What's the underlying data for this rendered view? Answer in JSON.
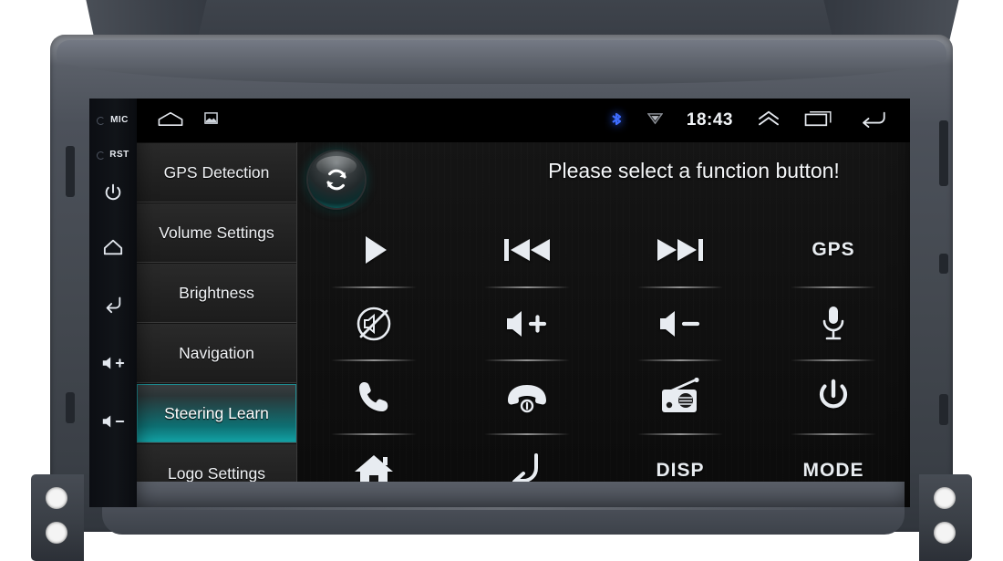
{
  "device": {
    "type": "car-head-unit",
    "bezel_color": "#4c515a",
    "screen_bg": "#000000"
  },
  "side_keys": [
    {
      "name": "mic",
      "label": "MIC",
      "icon": "mic-hole-icon"
    },
    {
      "name": "reset",
      "label": "RST",
      "icon": "reset-hole-icon"
    },
    {
      "name": "power",
      "label": "",
      "icon": "power-icon"
    },
    {
      "name": "home",
      "label": "",
      "icon": "home-icon"
    },
    {
      "name": "back",
      "label": "",
      "icon": "back-icon"
    },
    {
      "name": "volume-up",
      "label": "",
      "icon": "volume-up-icon"
    },
    {
      "name": "volume-down",
      "label": "",
      "icon": "volume-down-icon"
    }
  ],
  "statusbar": {
    "left_icons": [
      "home-outline-icon",
      "screenshot-icon"
    ],
    "bluetooth_icon": "bluetooth-icon",
    "bluetooth_color": "#2b5fff",
    "signal_icon": "signal-icon",
    "time": "18:43",
    "right_icons": [
      "chevron-up-icon",
      "recents-icon",
      "back-arrow-icon"
    ]
  },
  "sidebar": {
    "items": [
      {
        "label": "GPS Detection",
        "active": false
      },
      {
        "label": "Volume Settings",
        "active": false
      },
      {
        "label": "Brightness",
        "active": false
      },
      {
        "label": "Navigation",
        "active": false
      },
      {
        "label": "Steering Learn",
        "active": true
      },
      {
        "label": "Logo Settings",
        "active": false
      }
    ],
    "active_color": "#12a3a6"
  },
  "main": {
    "refresh_label": "reset-refresh-button",
    "hint": "Please select a function button!",
    "buttons": [
      {
        "row": 1,
        "col": 1,
        "icon": "play-icon",
        "label": ""
      },
      {
        "row": 1,
        "col": 2,
        "icon": "previous-icon",
        "label": ""
      },
      {
        "row": 1,
        "col": 3,
        "icon": "next-icon",
        "label": ""
      },
      {
        "row": 1,
        "col": 4,
        "icon": "gps-text-icon",
        "label": "GPS"
      },
      {
        "row": 2,
        "col": 1,
        "icon": "mute-icon",
        "label": ""
      },
      {
        "row": 2,
        "col": 2,
        "icon": "volume-up-icon",
        "label": ""
      },
      {
        "row": 2,
        "col": 3,
        "icon": "volume-down-icon",
        "label": ""
      },
      {
        "row": 2,
        "col": 4,
        "icon": "microphone-icon",
        "label": ""
      },
      {
        "row": 3,
        "col": 1,
        "icon": "call-icon",
        "label": ""
      },
      {
        "row": 3,
        "col": 2,
        "icon": "hangup-icon",
        "label": ""
      },
      {
        "row": 3,
        "col": 3,
        "icon": "radio-icon",
        "label": ""
      },
      {
        "row": 3,
        "col": 4,
        "icon": "power-icon",
        "label": ""
      },
      {
        "row": 4,
        "col": 1,
        "icon": "home-icon",
        "label": ""
      },
      {
        "row": 4,
        "col": 2,
        "icon": "back-icon",
        "label": ""
      },
      {
        "row": 4,
        "col": 3,
        "icon": "disp-text-icon",
        "label": "DISP"
      },
      {
        "row": 4,
        "col": 4,
        "icon": "mode-text-icon",
        "label": "MODE"
      }
    ]
  }
}
